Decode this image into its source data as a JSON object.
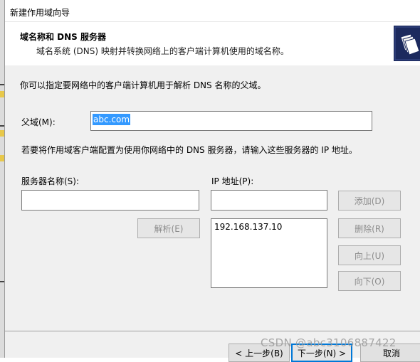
{
  "window": {
    "title": "新建作用域向导"
  },
  "header": {
    "title": "域名称和 DNS 服务器",
    "subtitle": "域名系统 (DNS) 映射并转换网络上的客户端计算机使用的域名称。",
    "icon": "folder-wizard-icon"
  },
  "main": {
    "intro": "你可以指定要网络中的客户端计算机用于解析 DNS 名称的父域。",
    "parent_domain_label": "父域(M):",
    "parent_domain_value": "abc.com",
    "dns_instruction": "若要将作用域客户端配置为使用你网络中的 DNS 服务器，请输入这些服务器的 IP 地址。",
    "server_name_label": "服务器名称(S):",
    "server_name_value": "",
    "ip_label": "IP 地址(P):",
    "ip_value": "",
    "resolve_button": "解析(E)",
    "add_button": "添加(D)",
    "remove_button": "删除(R)",
    "up_button": "向上(U)",
    "down_button": "向下(O)",
    "ip_list": [
      "192.168.137.10"
    ]
  },
  "footer": {
    "back_button": "< 上一步(B)",
    "next_button": "下一步(N) >",
    "cancel_button": "取消"
  },
  "watermark": "CSDN @abc3106887422",
  "colors": {
    "selection": "#3399ff",
    "focus_border": "#0078d7",
    "dialog_bg": "#f0f0f0"
  }
}
